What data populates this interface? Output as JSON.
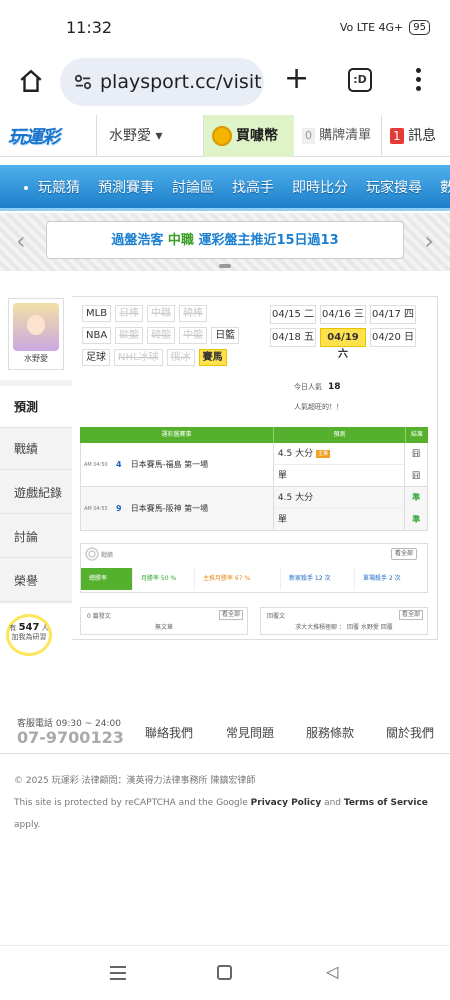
{
  "status": {
    "time": "11:32",
    "battery": "95",
    "net": "Vo LTE 4G+"
  },
  "browser": {
    "url": "playsport.cc/visit",
    "tabs": ":D"
  },
  "site": {
    "logo": "玩運彩",
    "user": "水野愛",
    "buy": "買噱幣",
    "cart_count": "0",
    "cart": "購牌清單",
    "msg_count": "1",
    "msg": "訊息"
  },
  "nav": [
    "玩競猜",
    "預測賽事",
    "討論區",
    "找高手",
    "即時比分",
    "玩家搜尋",
    "數據"
  ],
  "ticker": {
    "name": "過盤浩客",
    "league": "中職",
    "text": "運彩盤主推近15日過13"
  },
  "sidebar": {
    "avatar_name": "水野愛",
    "items": [
      "預測",
      "戰績",
      "遊戲紀錄",
      "討論",
      "榮譽"
    ],
    "bulb_prefix": "有",
    "bulb_count": "547",
    "bulb_suffix": "人",
    "bulb_line2": "加我為研習"
  },
  "leagues": [
    [
      {
        "t": "MLB",
        "s": "n"
      },
      {
        "t": "日棒",
        "s": "off"
      },
      {
        "t": "中職",
        "s": "off"
      },
      {
        "t": "韓棒",
        "s": "off"
      }
    ],
    [
      {
        "t": "NBA",
        "s": "n"
      },
      {
        "t": "歐籃",
        "s": "off"
      },
      {
        "t": "韓籃",
        "s": "off"
      },
      {
        "t": "中籃",
        "s": "off"
      },
      {
        "t": "日籃",
        "s": "n"
      }
    ],
    [
      {
        "t": "足球",
        "s": "n"
      },
      {
        "t": "NHL冰球",
        "s": "off"
      },
      {
        "t": "俄冰",
        "s": "off"
      },
      {
        "t": "賽馬",
        "s": "on"
      }
    ]
  ],
  "dates": [
    {
      "t": "04/15 二",
      "s": false
    },
    {
      "t": "04/16 三",
      "s": false
    },
    {
      "t": "04/17 四",
      "s": false
    },
    {
      "t": "04/18 五",
      "s": false
    },
    {
      "t": "04/19 六",
      "s": true
    },
    {
      "t": "04/20 日",
      "s": false
    }
  ],
  "popularity": {
    "label": "今日人氣",
    "value": "18",
    "note": "人氣超旺的！！"
  },
  "table": {
    "headers": [
      "運彩盤賽事",
      "預測",
      "結果"
    ],
    "rows": [
      {
        "time": "AM 04:50",
        "num": "4",
        "name": "日本賽馬-福島 第一場",
        "preds": [
          "4.5 大分",
          "單"
        ],
        "badge": "主推",
        "results": [
          "囧",
          "囧"
        ]
      },
      {
        "time": "AM 04:55",
        "num": "9",
        "name": "日本賽馬-阪神 第一場",
        "preds": [
          "4.5 大分",
          "單"
        ],
        "badge": "",
        "results": [
          "準",
          "準"
        ]
      }
    ]
  },
  "record": {
    "title": "戰績",
    "view": "看全部",
    "cells": [
      "總勝率",
      "月勝率 50 %",
      "主推月勝率 67 %",
      "新家殺手 12 次",
      "單場殺手 2 次"
    ]
  },
  "articles": [
    {
      "t": "0 篇發文",
      "v": "看全部",
      "c": "無文章"
    },
    {
      "t": "回覆文",
      "v": "看全部",
      "c": "求大大推積極聊 ： 回覆 水野愛 回覆"
    }
  ],
  "footer": {
    "svc": "客服電話 09:30 ~ 24:00",
    "phone": "07-9700123",
    "links": [
      "聯絡我們",
      "常見問題",
      "服務條款",
      "關於我們"
    ],
    "copy": "© 2025 玩運彩 法律顧問：漢英得力法律事務所 陳鎮宏律師",
    "cap_a": "This site is protected by reCAPTCHA and the Google ",
    "cap_b": "Privacy Policy",
    "cap_c": " and ",
    "cap_d": "Terms of Service",
    "cap_e": " apply."
  }
}
